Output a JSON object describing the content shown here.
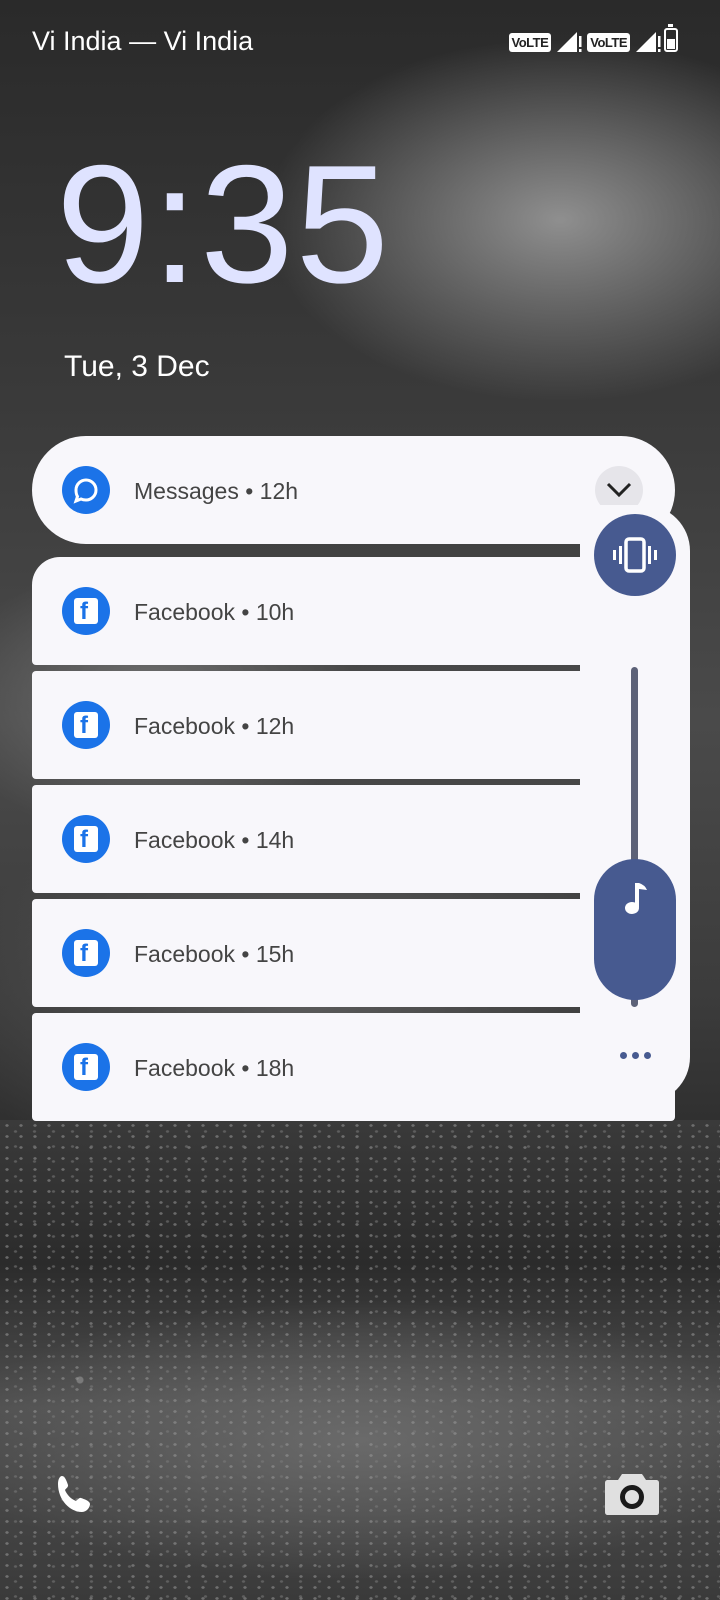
{
  "status_bar": {
    "carrier": "Vi India — Vi India",
    "volte_1": "VoLTE",
    "volte_2": "VoLTE",
    "icons": [
      "volte-icon",
      "signal-icon",
      "volte-icon",
      "signal-icon",
      "battery-icon"
    ]
  },
  "lockscreen": {
    "time": "9:35",
    "date": "Tue, 3 Dec"
  },
  "notifications": [
    {
      "app": "Messages",
      "age": "12h",
      "label": "Messages • 12h",
      "icon": "messages-icon"
    },
    {
      "app": "Facebook",
      "age": "10h",
      "label": "Facebook • 10h",
      "icon": "facebook-icon"
    },
    {
      "app": "Facebook",
      "age": "12h",
      "label": "Facebook • 12h",
      "icon": "facebook-icon"
    },
    {
      "app": "Facebook",
      "age": "14h",
      "label": "Facebook • 14h",
      "icon": "facebook-icon"
    },
    {
      "app": "Facebook",
      "age": "15h",
      "label": "Facebook • 15h",
      "icon": "facebook-icon"
    },
    {
      "app": "Facebook",
      "age": "18h",
      "label": "Facebook • 18h",
      "icon": "facebook-icon"
    }
  ],
  "volume_panel": {
    "ringer_mode": "vibrate",
    "stream": "media",
    "level": 0.0,
    "icons": [
      "vibrate-icon",
      "music-note-icon",
      "more-icon"
    ]
  },
  "shortcuts": {
    "left": "phone-icon",
    "right": "camera-icon"
  },
  "colors": {
    "clock": "#dfe3ff",
    "accent": "#475a90",
    "app_icon": "#1b73e8",
    "card": "#f8f7fb"
  }
}
